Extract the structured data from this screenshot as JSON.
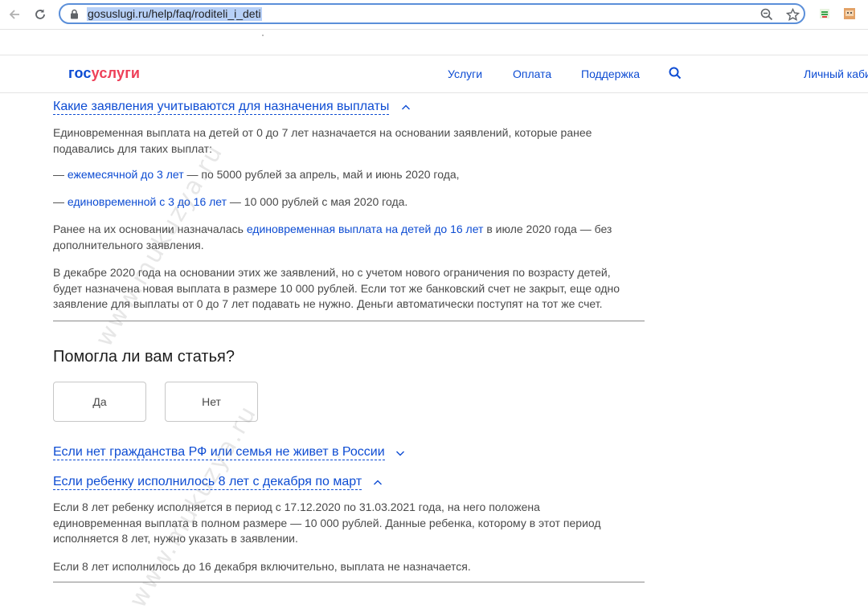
{
  "browser": {
    "url": "gosuslugi.ru/help/faq/roditeli_i_deti"
  },
  "header": {
    "logo_part1": "гос",
    "logo_part2": "услуги",
    "nav": [
      "Услуги",
      "Оплата",
      "Поддержка"
    ],
    "account": "Личный каби"
  },
  "faq": {
    "q1": {
      "title": "Какие заявления учитываются для назначения выплаты",
      "p1": "Единовременная выплата на детей от 0 до 7 лет назначается на основании заявлений, которые ранее подавались для таких выплат:",
      "item1_prefix": "— ",
      "item1_link": "ежемесячной до 3 лет",
      "item1_suffix": " — по 5000 рублей за апрель, май и июнь 2020 года,",
      "item2_prefix": "— ",
      "item2_link": "единовременной с 3 до 16 лет",
      "item2_suffix": " — 10 000 рублей с мая 2020 года.",
      "p2_prefix": "Ранее на их основании назначалась ",
      "p2_link": "единовременная выплата на детей до 16 лет",
      "p2_suffix": " в июле 2020 года — без дополнительного заявления.",
      "p3": "В декабре 2020 года на основании этих же заявлений, но с учетом нового ограничения по возрасту детей, будет назначена новая выплата в размере 10 000 рублей. Если тот же банковский счет не закрыт, еще одно заявление для выплаты от 0 до 7 лет подавать не нужно. Деньги автоматически поступят на тот же счет."
    },
    "feedback": {
      "title": "Помогла ли вам статья?",
      "yes": "Да",
      "no": "Нет"
    },
    "q2": {
      "title": "Если нет гражданства РФ или семья не живет в России"
    },
    "q3": {
      "title": "Если ребенку исполнилось 8 лет с декабря по март",
      "p1": "Если 8 лет ребенку исполняется в период с 17.12.2020 по 31.03.2021 года, на него положена единовременная выплата в полном размере — 10 000 рублей. Данные ребенка, которому в этот период исполняется 8 лет, нужно указать в заявлении.",
      "p2": "Если 8 лет исполнилось до 16 декабря включительно, выплата не назначается."
    }
  },
  "watermark": "www.mukuzya.ru",
  "colors": {
    "link": "#0d4cd3",
    "logo_red": "#ee3f58",
    "text": "#4a4a4a"
  }
}
